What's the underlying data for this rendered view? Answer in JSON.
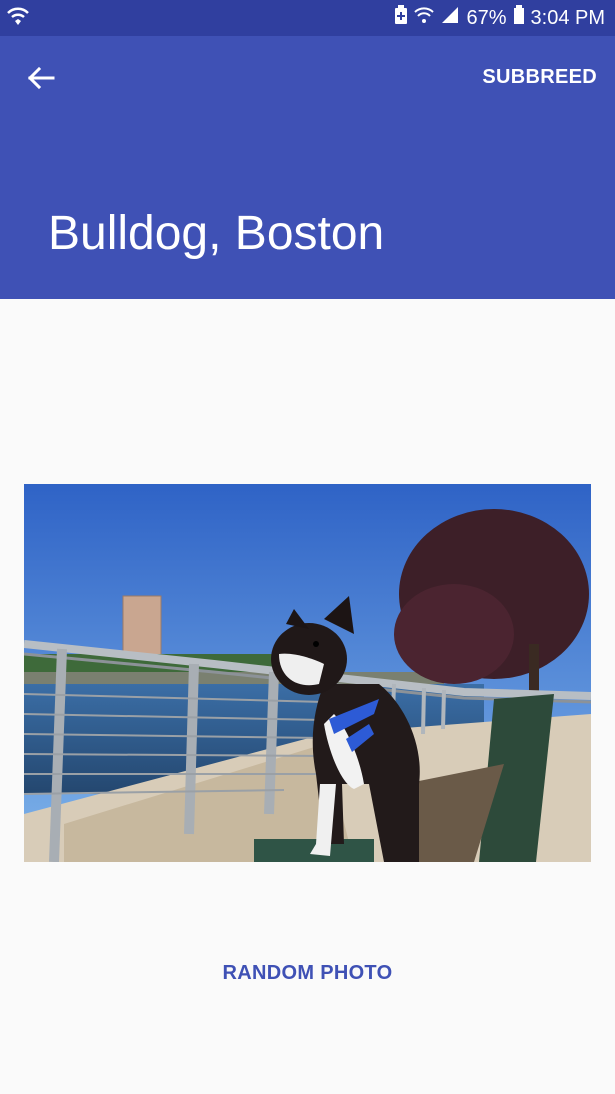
{
  "status_bar": {
    "battery_percent": "67%",
    "time": "3:04 PM",
    "icons": [
      "wifi-calling-icon",
      "battery-saver-icon",
      "wifi-icon",
      "signal-icon",
      "battery-icon"
    ]
  },
  "app_bar": {
    "back_icon": "arrow-left-icon",
    "action_label": "SUBBREED",
    "title": "Bulldog, Boston",
    "color": "#3f51b5"
  },
  "main": {
    "photo_subject": "boston-terrier-on-bench-photo",
    "random_button_label": "RANDOM PHOTO"
  },
  "colors": {
    "primary": "#3f51b5",
    "primary_dark": "#303f9f",
    "background": "#fafafa"
  }
}
